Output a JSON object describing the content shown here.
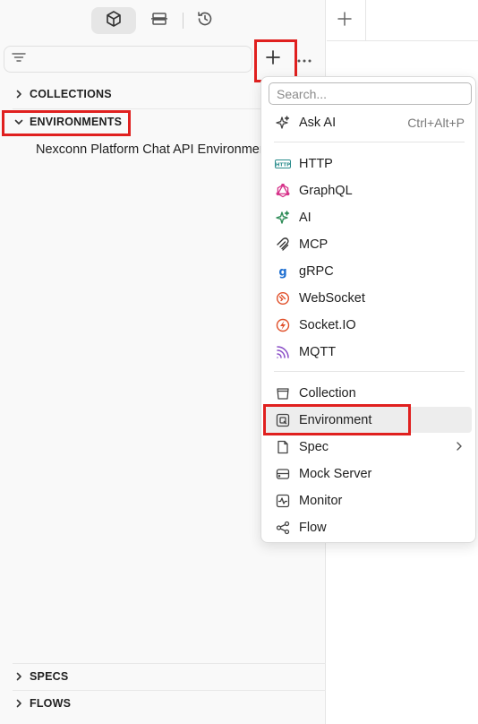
{
  "sidebar": {
    "topbar": {
      "tabs": [
        {
          "icon": "cube-icon"
        },
        {
          "icon": "mock-server-icon"
        },
        {
          "icon": "history-icon"
        }
      ]
    },
    "filter": {
      "icon": "filter-icon"
    },
    "sections": {
      "collections": "COLLECTIONS",
      "environments": "ENVIRONMENTS",
      "specs": "SPECS",
      "flows": "FLOWS"
    },
    "environment_items": [
      "Nexconn Platform Chat API Environment"
    ]
  },
  "menu": {
    "search_placeholder": "Search...",
    "ask_ai": {
      "label": "Ask AI",
      "shortcut": "Ctrl+Alt+P"
    },
    "request_types": [
      {
        "label": "HTTP",
        "icon": "http-icon",
        "color": "#2a8c8c"
      },
      {
        "label": "GraphQL",
        "icon": "graphql-icon",
        "color": "#d6338a"
      },
      {
        "label": "AI",
        "icon": "ai-sparkle-icon",
        "color": "#2e8b57"
      },
      {
        "label": "MCP",
        "icon": "mcp-icon",
        "color": "#333333"
      },
      {
        "label": "gRPC",
        "icon": "grpc-icon",
        "color": "#1f6fd1"
      },
      {
        "label": "WebSocket",
        "icon": "websocket-icon",
        "color": "#e0502a"
      },
      {
        "label": "Socket.IO",
        "icon": "socketio-icon",
        "color": "#e0502a"
      },
      {
        "label": "MQTT",
        "icon": "mqtt-icon",
        "color": "#8a4fc7"
      }
    ],
    "entities": [
      {
        "label": "Collection",
        "icon": "collection-icon"
      },
      {
        "label": "Environment",
        "icon": "environment-icon"
      },
      {
        "label": "Spec",
        "icon": "spec-icon"
      },
      {
        "label": "Mock Server",
        "icon": "mock-server-icon"
      },
      {
        "label": "Monitor",
        "icon": "monitor-icon"
      },
      {
        "label": "Flow",
        "icon": "flow-icon"
      }
    ]
  },
  "colors": {
    "highlight": "#e0201f"
  }
}
